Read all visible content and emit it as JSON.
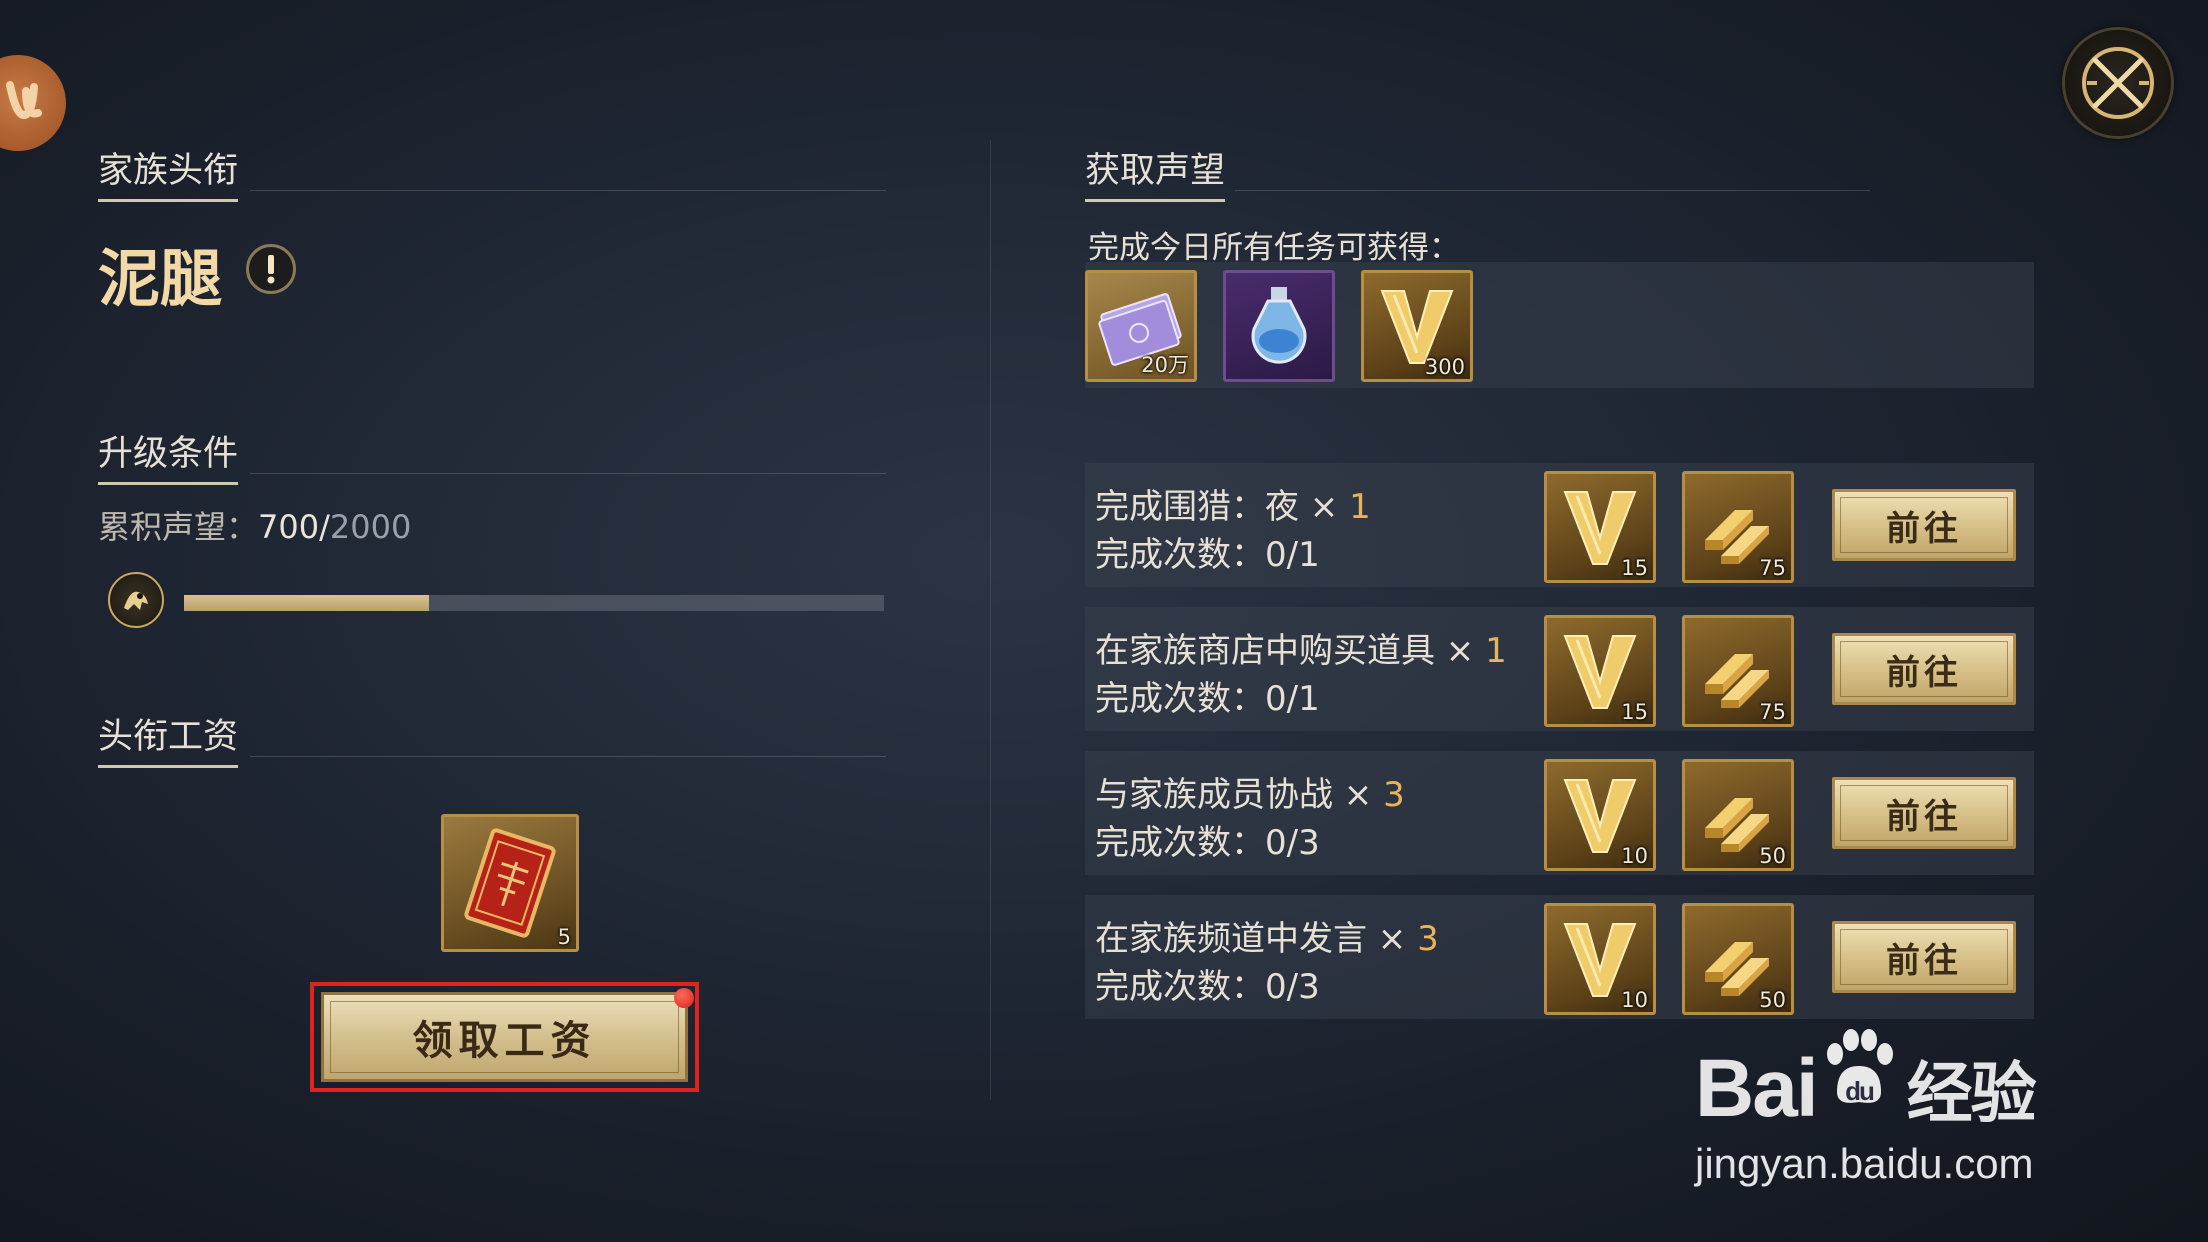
{
  "left": {
    "family_title_header": "家族头衔",
    "rank_name": "泥腿",
    "upgrade_header": "升级条件",
    "reputation_label": "累积声望：",
    "reputation_current": "700",
    "reputation_separator": "/",
    "reputation_total": "2000",
    "reputation_progress": 0.35,
    "salary_header": "头衔工资",
    "salary_item_count": "5",
    "claim_button": "领取工资"
  },
  "right": {
    "header": "获取声望",
    "daily_text": "完成今日所有任务可获得：",
    "daily_rewards": [
      {
        "icon": "silver-note-icon",
        "count": "20万"
      },
      {
        "icon": "potion-bottle-icon",
        "count": ""
      },
      {
        "icon": "v-reputation-icon",
        "count": "300"
      }
    ],
    "tasks": [
      {
        "name": "完成围猎：夜 ×",
        "times": "1",
        "count_label": "完成次数：",
        "progress": "0/1",
        "rep": "15",
        "gold": "75",
        "button": "前往"
      },
      {
        "name": "在家族商店中购买道具 ×",
        "times": "1",
        "count_label": "完成次数：",
        "progress": "0/1",
        "rep": "15",
        "gold": "75",
        "button": "前往"
      },
      {
        "name": "与家族成员协战 ×",
        "times": "3",
        "count_label": "完成次数：",
        "progress": "0/3",
        "rep": "10",
        "gold": "50",
        "button": "前往"
      },
      {
        "name": "在家族频道中发言 ×",
        "times": "3",
        "count_label": "完成次数：",
        "progress": "0/3",
        "rep": "10",
        "gold": "50",
        "button": "前往"
      }
    ]
  },
  "watermark": {
    "brand": "Bai",
    "brand2": "经验",
    "url": "jingyan.baidu.com"
  },
  "colors": {
    "accent_gold": "#e7b45a",
    "bar_fill": "#c9b27a",
    "highlight_red": "#e0231c"
  }
}
